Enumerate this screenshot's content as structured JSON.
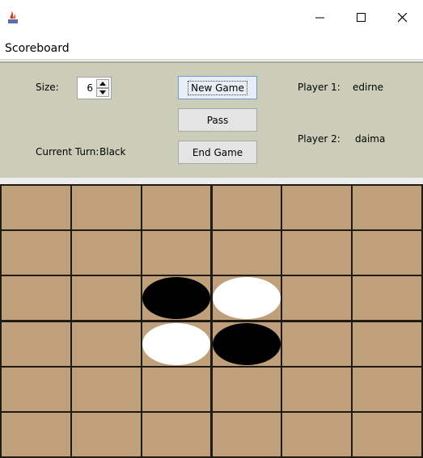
{
  "window": {
    "menu": [
      "Scoreboard"
    ]
  },
  "controls": {
    "size_label": "Size:",
    "size_value": "6",
    "current_turn_label": "Current Turn:",
    "current_turn_value": "Black",
    "buttons": {
      "new_game": "New Game",
      "pass": "Pass",
      "end_game": "End Game"
    },
    "player1_label": "Player 1:",
    "player1_name": "edirne",
    "player2_label": "Player 2:",
    "player2_name": "daima"
  },
  "board": {
    "size": 6,
    "cell_color": "#bfa07a",
    "grid_color": "#1f1a14",
    "discs": [
      {
        "row": 2,
        "col": 2,
        "color": "black"
      },
      {
        "row": 2,
        "col": 3,
        "color": "white"
      },
      {
        "row": 3,
        "col": 2,
        "color": "white"
      },
      {
        "row": 3,
        "col": 3,
        "color": "black"
      }
    ]
  }
}
